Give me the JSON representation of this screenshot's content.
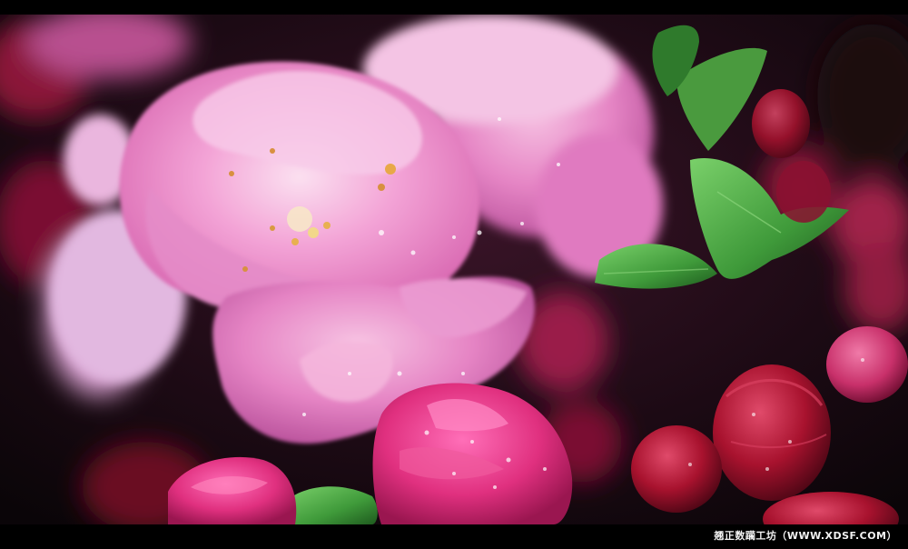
{
  "watermark": {
    "text": "翘正数躏工坊（WWW.XDSF.COM）"
  },
  "colors": {
    "frame": "#000000",
    "background": "#1a0a10",
    "petal_light": "#f3a3d6",
    "petal_mid": "#e070b8",
    "petal_deep": "#c0307a",
    "bud_red": "#a8122e",
    "leaf_green": "#3f9a3a"
  }
}
